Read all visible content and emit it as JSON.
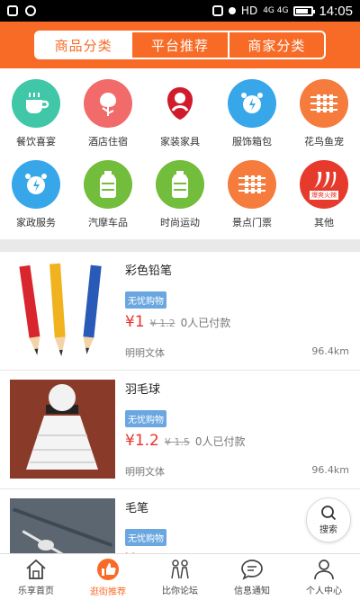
{
  "status": {
    "time": "14:05",
    "network": "HD",
    "signal": "4G 4G"
  },
  "header": {
    "tabs": [
      {
        "label": "商品分类",
        "active": true
      },
      {
        "label": "平台推荐",
        "active": false
      },
      {
        "label": "商家分类",
        "active": false
      }
    ]
  },
  "categories": [
    {
      "label": "餐饮喜宴",
      "icon": "cup-icon",
      "color": "#3fc7a8"
    },
    {
      "label": "酒店住宿",
      "icon": "flower-icon",
      "color": "#f26b6b"
    },
    {
      "label": "家装家具",
      "icon": "mother-child-icon",
      "color": "#ffffff"
    },
    {
      "label": "服饰箱包",
      "icon": "alarm-clock-icon",
      "color": "#37a7ea"
    },
    {
      "label": "花鸟鱼宠",
      "icon": "skewer-icon",
      "color": "#f67c3e"
    },
    {
      "label": "家政服务",
      "icon": "alarm-clock-icon",
      "color": "#37a7ea"
    },
    {
      "label": "汽摩车品",
      "icon": "water-bottle-icon",
      "color": "#72bd3b"
    },
    {
      "label": "时尚运动",
      "icon": "water-bottle-icon",
      "color": "#72bd3b"
    },
    {
      "label": "景点门票",
      "icon": "skewer-icon",
      "color": "#f67c3e"
    },
    {
      "label": "其他",
      "icon": "chili-icon",
      "color": "#e63b2c",
      "badge": "爆爽火辣"
    }
  ],
  "products": [
    {
      "title": "彩色铅笔",
      "tag": "无忧购物",
      "price": "¥1",
      "old_price": "¥ 1.2",
      "paid": "0人已付款",
      "shop": "明明文体",
      "distance": "96.4km"
    },
    {
      "title": "羽毛球",
      "tag": "无忧购物",
      "price": "¥1.2",
      "old_price": "¥ 1.5",
      "paid": "0人已付款",
      "shop": "明明文体",
      "distance": "96.4km"
    },
    {
      "title": "毛笔",
      "tag": "无忧购物",
      "price": "¥",
      "old_price": "",
      "paid": "",
      "shop": "",
      "distance": ""
    }
  ],
  "search_fab": {
    "label": "搜索"
  },
  "tabbar": [
    {
      "label": "乐享首页",
      "icon": "home-icon",
      "active": false
    },
    {
      "label": "逛街推荐",
      "icon": "thumbs-up-icon",
      "active": true
    },
    {
      "label": "比你论坛",
      "icon": "couple-icon",
      "active": false
    },
    {
      "label": "信息通知",
      "icon": "chat-bubble-icon",
      "active": false
    },
    {
      "label": "个人中心",
      "icon": "person-icon",
      "active": false
    }
  ],
  "colors": {
    "brand": "#f86b27",
    "price": "#e7332c",
    "tag": "#6aa7e0"
  }
}
